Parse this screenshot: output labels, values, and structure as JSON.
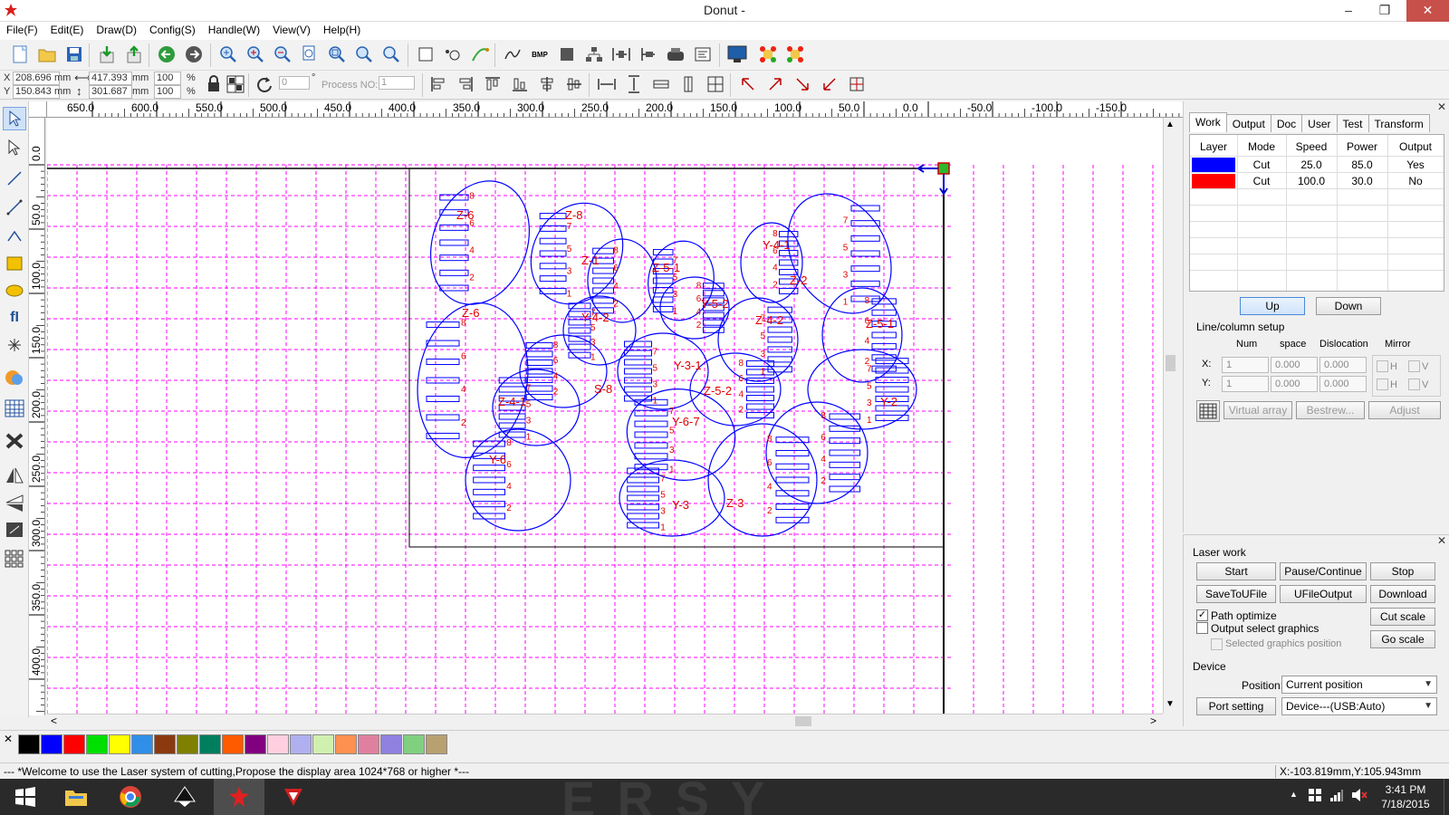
{
  "window": {
    "title": "Donut -",
    "minimize": "–",
    "maximize": "❐",
    "close": "✕"
  },
  "menu": [
    "File(F)",
    "Edit(E)",
    "Draw(D)",
    "Config(S)",
    "Handle(W)",
    "View(V)",
    "Help(H)"
  ],
  "coords": {
    "x_label": "X",
    "y_label": "Y",
    "x_value": "208.696",
    "y_value": "150.843",
    "x_unit": "mm",
    "y_unit": "mm",
    "width_value": "417.393",
    "height_value": "301.687",
    "width_unit": "mm",
    "height_unit": "mm",
    "scale_x": "100",
    "scale_y": "100",
    "pct_x": "%",
    "pct_y": "%",
    "rotate_value": "0",
    "degree": "°",
    "process_no_label": "Process NO:",
    "process_no_value": "1"
  },
  "rulers": {
    "horizontal": [
      "650.0",
      "600.0",
      "550.0",
      "500.0",
      "450.0",
      "400.0",
      "350.0",
      "300.0",
      "250.0",
      "200.0",
      "150.0",
      "100.0",
      "50.0",
      "0.0",
      "-50.0",
      "-100.0",
      "-150.0"
    ],
    "vertical": [
      "0.0",
      "50.0",
      "100.0",
      "150.0",
      "200.0",
      "250.0",
      "300.0",
      "350.0",
      "400.0"
    ]
  },
  "work_panel": {
    "tabs": [
      "Work",
      "Output",
      "Doc",
      "User",
      "Test",
      "Transform"
    ],
    "active_tab": "Work",
    "table_headers": [
      "Layer",
      "Mode",
      "Speed",
      "Power",
      "Output"
    ],
    "layers": [
      {
        "color": "#0000ff",
        "mode": "Cut",
        "speed": "25.0",
        "power": "85.0",
        "output": "Yes"
      },
      {
        "color": "#ff0000",
        "mode": "Cut",
        "speed": "100.0",
        "power": "30.0",
        "output": "No"
      }
    ],
    "up_button": "Up",
    "down_button": "Down",
    "line_column_setup": "Line/column setup",
    "num_label": "Num",
    "space_label": "space",
    "dislocation_label": "Dislocation",
    "mirror_label": "Mirror",
    "x_label": "X:",
    "y_label": "Y:",
    "x_num": "1",
    "y_num": "1",
    "x_space": "0.000",
    "y_space": "0.000",
    "x_dislocation": "0.000",
    "y_dislocation": "0.000",
    "h_label": "H",
    "v_label": "V",
    "virtual_array": "Virtual array",
    "bestrew": "Bestrew...",
    "adjust": "Adjust"
  },
  "laser_panel": {
    "title": "Laser work",
    "start": "Start",
    "pause_continue": "Pause/Continue",
    "stop": "Stop",
    "save_to_ufile": "SaveToUFile",
    "ufile_output": "UFileOutput",
    "download": "Download",
    "path_optimize": "Path optimize",
    "output_select_graphics": "Output select graphics",
    "selected_graphics_position": "Selected graphics position",
    "cut_scale": "Cut scale",
    "go_scale": "Go scale",
    "device_title": "Device",
    "position_label": "Position:",
    "position_value": "Current position",
    "port_setting": "Port setting",
    "device_value": "Device---(USB:Auto)"
  },
  "palette": [
    "#000000",
    "#0000ff",
    "#ff0000",
    "#00e000",
    "#ffff00",
    "#2f8fe8",
    "#8b3a0f",
    "#7f7f00",
    "#007f5f",
    "#ff5a00",
    "#800080",
    "#ffcfe0",
    "#b0b0f0",
    "#d0f0b0",
    "#ff9050",
    "#e080a0",
    "#9080e0",
    "#80d080",
    "#b8a070"
  ],
  "status": {
    "message": "--- *Welcome to use the Laser system of cutting,Propose the display area 1024*768 or higher *---",
    "cursor": "X:-103.819mm,Y:105.943mm"
  },
  "canvas_labels": [
    {
      "t": "Z-6"
    },
    {
      "t": "Z-8"
    },
    {
      "t": "Z-1"
    },
    {
      "t": "Z-5-1"
    },
    {
      "t": "Y-4-1"
    },
    {
      "t": "Z-2"
    },
    {
      "t": "Z-6"
    },
    {
      "t": "Y-4-2"
    },
    {
      "t": "Y-5-2"
    },
    {
      "t": "Z-4-2"
    },
    {
      "t": "Z-5-1"
    },
    {
      "t": "Y-3-1"
    },
    {
      "t": "S-8"
    },
    {
      "t": "Z-4-1"
    },
    {
      "t": "Z-5-2"
    },
    {
      "t": "Y-6-7"
    },
    {
      "t": "Y-6"
    },
    {
      "t": "Y-3"
    },
    {
      "t": "Z-3"
    },
    {
      "t": "Y-2"
    }
  ],
  "taskbar": {
    "time": "3:41 PM",
    "date": "7/18/2015",
    "watermark": "ERSY"
  }
}
